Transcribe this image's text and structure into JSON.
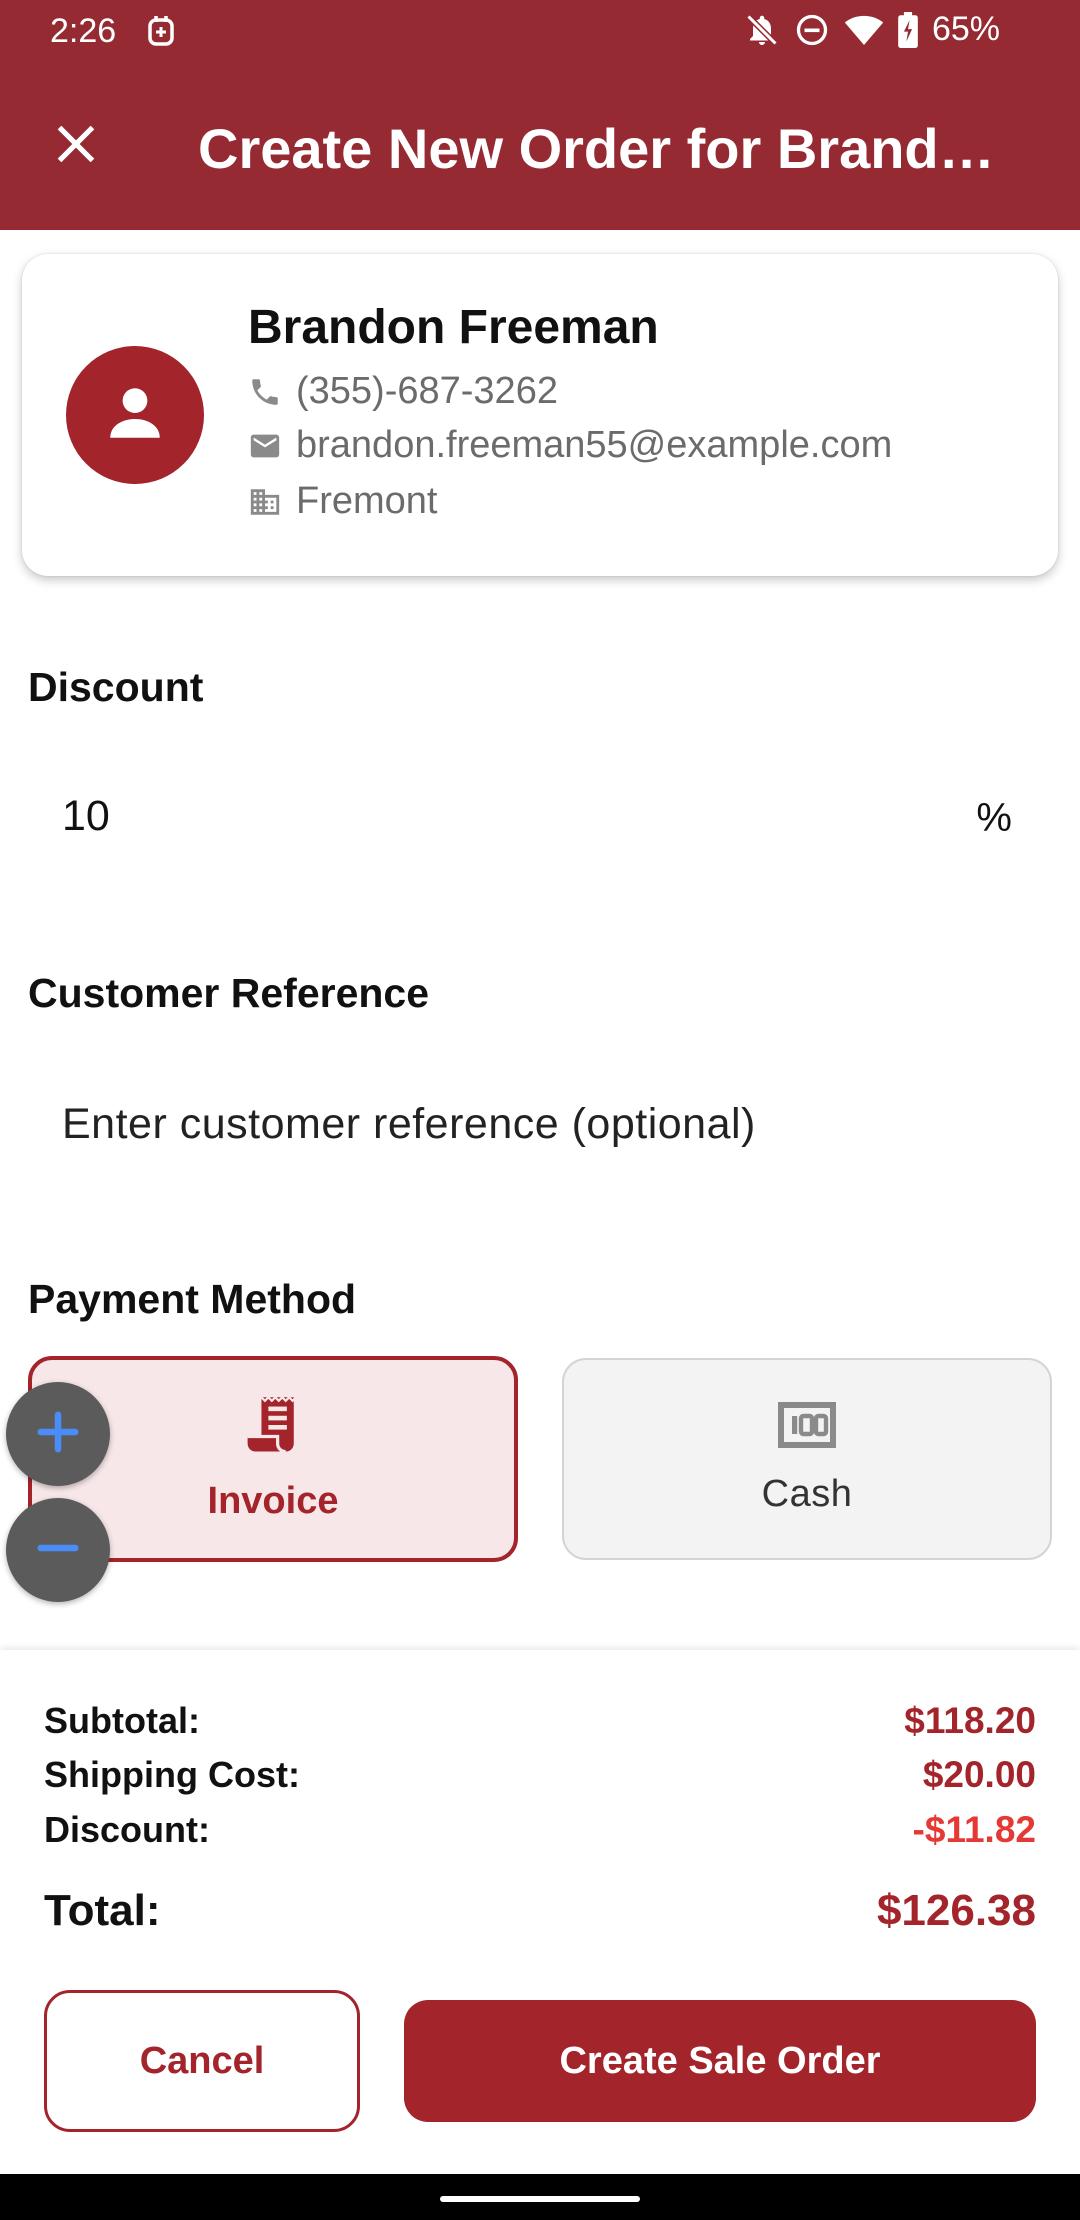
{
  "status_bar": {
    "time": "2:26",
    "battery": "65%",
    "icons": [
      "vpn-icon",
      "notifications-off-icon",
      "do-not-disturb-icon",
      "wifi-icon",
      "battery-charging-icon"
    ]
  },
  "app_bar": {
    "title": "Create New Order for Brandon Freeman",
    "close_icon": "close-icon"
  },
  "customer": {
    "name": "Brandon Freeman",
    "phone": "(355)-687-3262",
    "email": "brandon.freeman55@example.com",
    "city": "Fremont",
    "icons": [
      "person-icon",
      "phone-icon",
      "email-icon",
      "building-icon"
    ]
  },
  "discount": {
    "label": "Discount",
    "value": "10",
    "suffix": "%"
  },
  "customer_reference": {
    "label": "Customer Reference",
    "placeholder": "Enter customer reference (optional)"
  },
  "payment_method": {
    "label": "Payment Method",
    "options": [
      {
        "label": "Invoice",
        "icon": "receipt-icon",
        "selected": true
      },
      {
        "label": "Cash",
        "icon": "cash-icon",
        "selected": false
      }
    ]
  },
  "zoom": {
    "in_icon": "plus-icon",
    "out_icon": "minus-icon"
  },
  "summary": {
    "subtotal_label": "Subtotal:",
    "subtotal_value": "$118.20",
    "shipping_label": "Shipping Cost:",
    "shipping_value": "$20.00",
    "discount_label": "Discount:",
    "discount_value": "-$11.82",
    "total_label": "Total:",
    "total_value": "$126.38"
  },
  "actions": {
    "cancel": "Cancel",
    "create": "Create Sale Order"
  },
  "colors": {
    "primary": "#962a33",
    "accent": "#a3242a",
    "discount_negative": "#e53935",
    "selected_bg": "#f7e7e8",
    "fab_plus": "#4a8df8"
  }
}
